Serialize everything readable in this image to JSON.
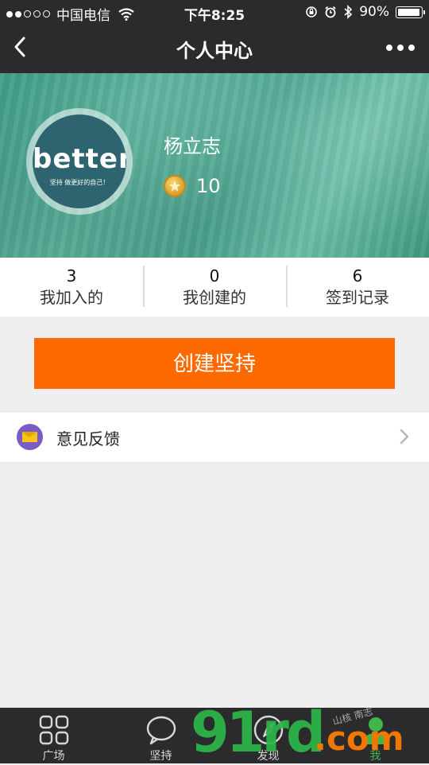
{
  "status_bar": {
    "carrier": "中国电信",
    "time": "下午8:25",
    "battery": "90%",
    "battery_level": 0.9
  },
  "nav": {
    "title": "个人中心"
  },
  "profile": {
    "username": "杨立志",
    "coins": "10",
    "avatar_logo": "better",
    "avatar_slogan": "坚持 做更好的自己！"
  },
  "stats": [
    {
      "value": "3",
      "label": "我加入的"
    },
    {
      "value": "0",
      "label": "我创建的"
    },
    {
      "value": "6",
      "label": "签到记录"
    }
  ],
  "create_button": {
    "label": "创建坚持"
  },
  "feedback": {
    "label": "意见反馈"
  },
  "tabs": [
    {
      "label": "广场",
      "icon": "grid-icon"
    },
    {
      "label": "坚持",
      "icon": "chat-bubble-icon"
    },
    {
      "label": "发现",
      "icon": "compass-icon"
    },
    {
      "label": "我",
      "icon": "person-icon",
      "active": true
    }
  ],
  "watermark": {
    "main": "91rd",
    "suffix": ".com",
    "small": "山核   南志"
  },
  "colors": {
    "bar_bg": "#2b2b2e",
    "accent_orange": "#ff6a00",
    "active_green": "#42b54a",
    "banner_teal": "#4aa58f"
  }
}
